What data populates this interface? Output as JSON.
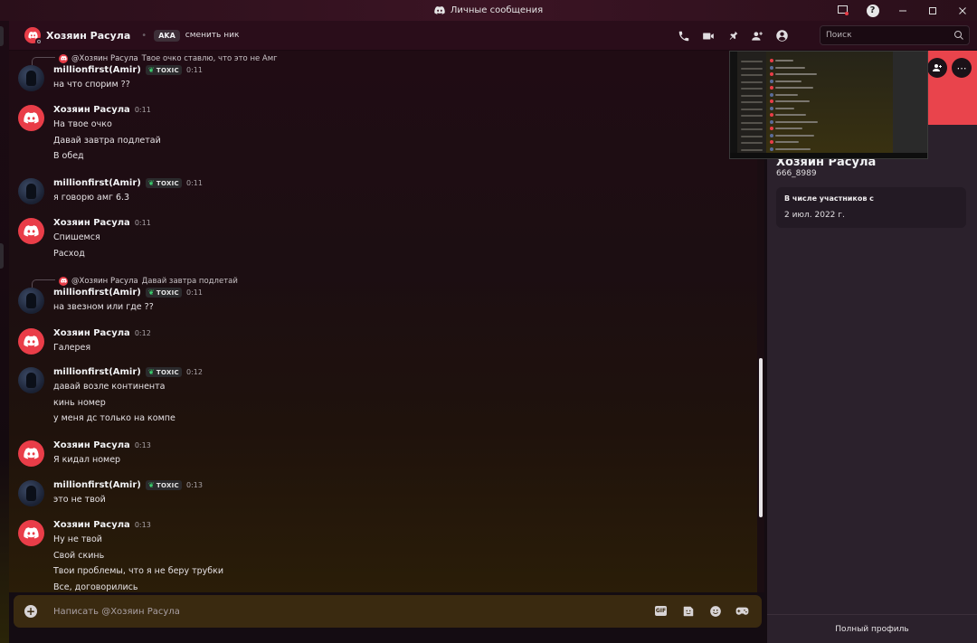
{
  "window": {
    "title": "Личные сообщения"
  },
  "header": {
    "name": "Хозяин Расула",
    "aka_label": "AKA",
    "nick_action": "сменить ник",
    "search_placeholder": "Поиск"
  },
  "messages": [
    {
      "type": "reply",
      "reply_to": "@Хозяин Расула",
      "reply_text": "Твое очко ставлю, что это не Амг"
    },
    {
      "author": "millionfirst(Amir)",
      "tag": "TOXIC",
      "time": "0:11",
      "lines": [
        "на что спорим ??"
      ]
    },
    {
      "author": "Хозяин Расула",
      "time": "0:11",
      "lines": [
        "На твое очко",
        "Давай завтра подлетай",
        "В обед"
      ]
    },
    {
      "author": "millionfirst(Amir)",
      "tag": "TOXIC",
      "time": "0:11",
      "lines": [
        "я говорю амг 6.3"
      ]
    },
    {
      "author": "Хозяин Расула",
      "time": "0:11",
      "lines": [
        "Спишемся",
        "Расход"
      ]
    },
    {
      "type": "reply",
      "reply_to": "@Хозяин Расула",
      "reply_text": "Давай завтра подлетай"
    },
    {
      "author": "millionfirst(Amir)",
      "tag": "TOXIC",
      "time": "0:11",
      "lines": [
        "на звезном или где ??"
      ]
    },
    {
      "author": "Хозяин Расула",
      "time": "0:12",
      "lines": [
        "Галерея"
      ]
    },
    {
      "author": "millionfirst(Amir)",
      "tag": "TOXIC",
      "time": "0:12",
      "lines": [
        "давай возле континента",
        "кинь номер",
        "у меня дс только на компе"
      ]
    },
    {
      "author": "Хозяин Расула",
      "time": "0:13",
      "lines": [
        "Я кидал номер"
      ]
    },
    {
      "author": "millionfirst(Amir)",
      "tag": "TOXIC",
      "time": "0:13",
      "lines": [
        "это не твой"
      ]
    },
    {
      "author": "Хозяин Расула",
      "time": "0:13",
      "lines": [
        "Ну не твой",
        "Свой скинь",
        "Твои проблемы, что я не беру трубки",
        "Все, договорились"
      ]
    }
  ],
  "composer": {
    "placeholder": "Написать @Хозяин Расула",
    "gif_label": "GIF"
  },
  "profile": {
    "name": "Хозяин Расула",
    "username": "666_8989",
    "member_since_label": "В числе участников с",
    "member_since_date": "2 июл. 2022 г.",
    "full_profile_label": "Полный профиль",
    "more_label": "⋯"
  },
  "colors": {
    "accent": "#e93d48",
    "online_tag": "#3bd16f"
  }
}
